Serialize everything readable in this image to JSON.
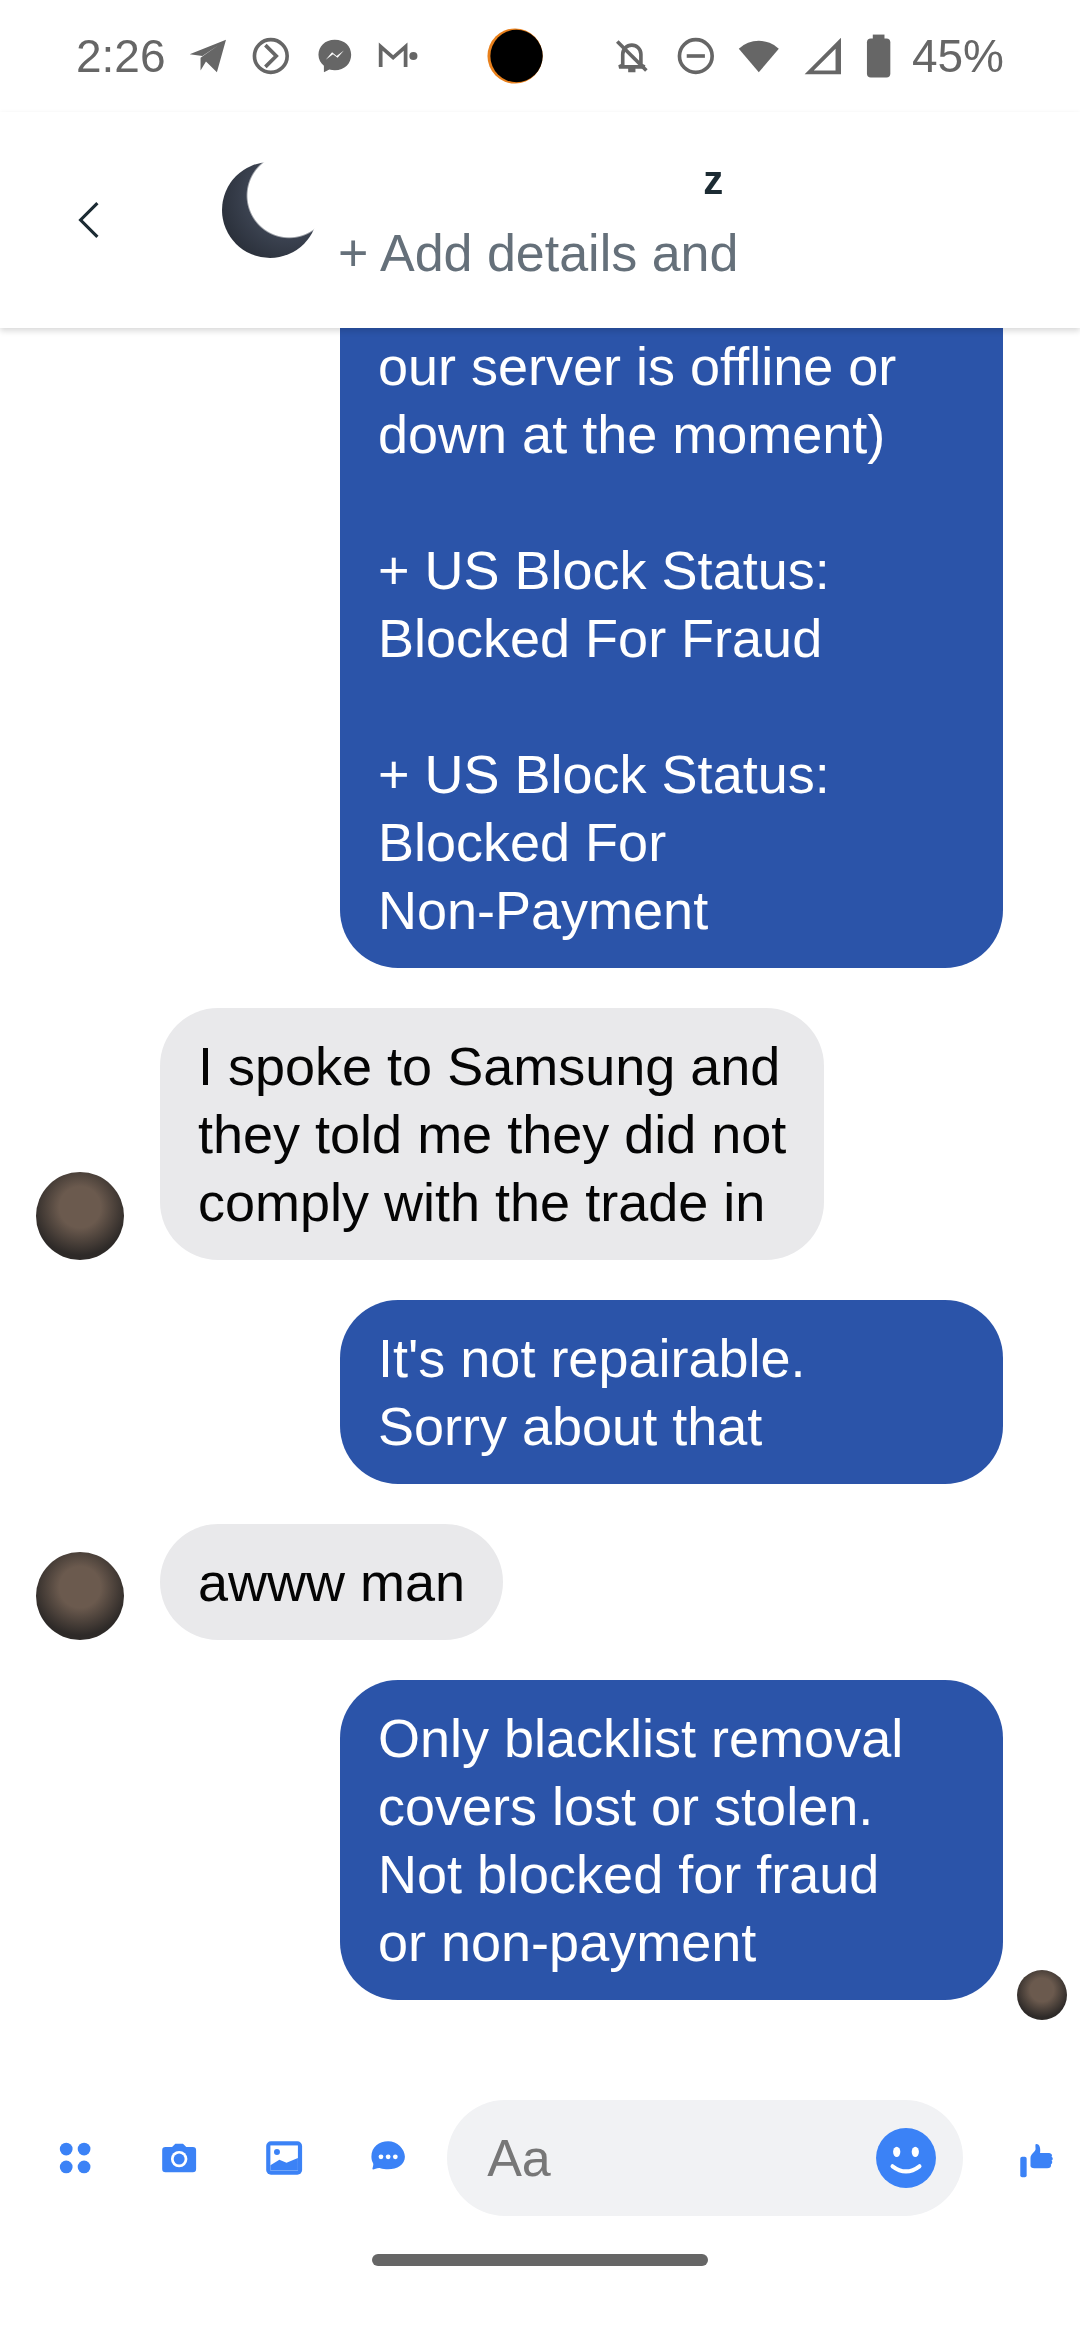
{
  "status_bar": {
    "time": "2:26",
    "battery": "45%"
  },
  "header": {
    "title": "z",
    "subtitle": "+ Add details and"
  },
  "messages": [
    {
      "kind": "sent",
      "continued": true,
      "avatar": false,
      "text": "our server is offline or\ndown at the moment)\n\n+ US Block Status:\nBlocked For Fraud\n\n+ US Block Status:\nBlocked For\nNon-Payment"
    },
    {
      "kind": "received",
      "continued": false,
      "avatar": true,
      "text": "I spoke to Samsung and\nthey told me they did not\ncomply with the trade in"
    },
    {
      "kind": "sent",
      "continued": false,
      "avatar": false,
      "text": "It's not repairable.\nSorry about that"
    },
    {
      "kind": "received",
      "continued": false,
      "avatar": true,
      "text": "awww man"
    },
    {
      "kind": "sent",
      "continued": false,
      "avatar": true,
      "text": "Only blacklist removal\ncovers lost or stolen.\nNot blocked for fraud\nor non-payment"
    }
  ],
  "composer": {
    "placeholder": "Aa"
  }
}
